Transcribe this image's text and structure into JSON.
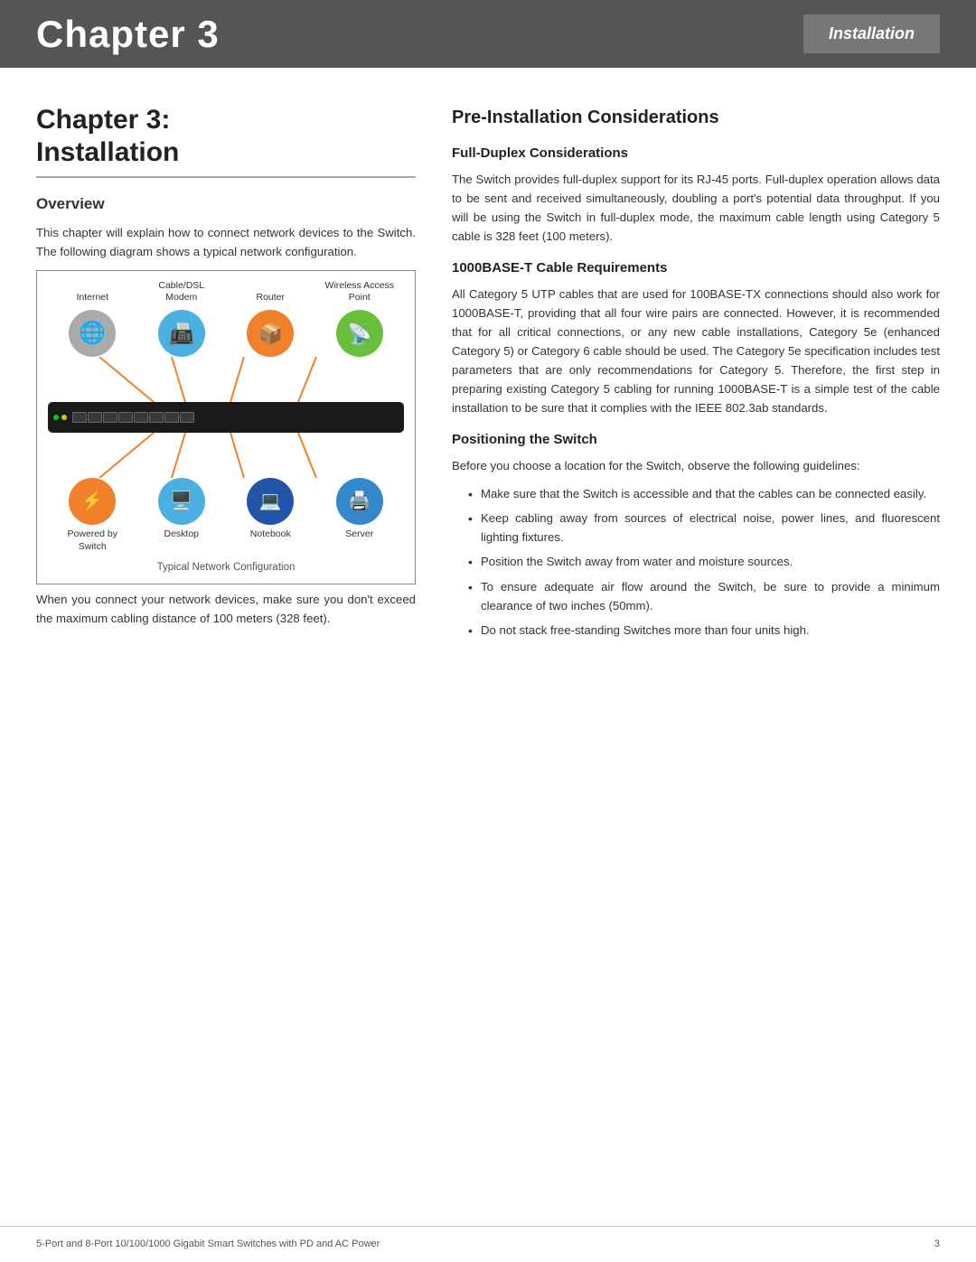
{
  "header": {
    "chapter_label": "Chapter 3",
    "section_label": "Installation"
  },
  "chapter_title_line1": "Chapter 3:",
  "chapter_title_line2": "Installation",
  "overview": {
    "heading": "Overview",
    "body": "This chapter will explain how to connect network devices to the Switch. The following diagram shows a typical network configuration.",
    "diagram_caption": "Typical Network Configuration",
    "after_diagram": "When you connect your network devices, make sure you don't exceed the maximum cabling distance of 100 meters (328 feet)."
  },
  "diagram": {
    "top_labels": [
      "Internet",
      "Cable/DSL\nModem",
      "Router",
      "Wireless Access\nPoint"
    ],
    "bottom_labels": [
      "Powered by\nSwitch",
      "Desktop",
      "Notebook",
      "Server"
    ]
  },
  "right_col": {
    "main_heading": "Pre-Installation Considerations",
    "full_duplex": {
      "heading": "Full-Duplex Considerations",
      "body": "The Switch provides full-duplex support for its RJ-45 ports. Full-duplex operation allows data to be sent and received simultaneously, doubling a port's potential data throughput. If you will be using the Switch in full-duplex mode, the maximum cable length using Category 5 cable is 328 feet (100 meters)."
    },
    "cable_req": {
      "heading": "1000BASE-T Cable Requirements",
      "body": "All Category 5 UTP cables that are used for 100BASE-TX connections should also work for 1000BASE-T, providing that all four wire pairs are connected. However, it is recommended that for all critical connections, or any new cable installations, Category 5e (enhanced Category 5) or Category 6 cable should be used. The Category 5e specification includes test parameters that are only recommendations for Category 5. Therefore, the first step in preparing existing Category 5 cabling for running 1000BASE-T is a simple test of the cable installation to be sure that it complies with the IEEE 802.3ab standards."
    },
    "positioning": {
      "heading": "Positioning the Switch",
      "intro": "Before you choose a location for the Switch, observe the following guidelines:",
      "bullets": [
        "Make sure that the Switch is accessible and that the cables can be connected easily.",
        "Keep cabling away from sources of electrical noise, power lines, and fluorescent lighting fixtures.",
        "Position the Switch away from water and moisture sources.",
        "To ensure adequate air flow around the Switch, be sure to provide a minimum clearance of two inches (50mm).",
        "Do not stack free-standing Switches more than four units high."
      ]
    }
  },
  "footer": {
    "left": "5-Port and 8-Port 10/100/1000 Gigabit Smart Switches with PD and AC Power",
    "right": "3"
  }
}
